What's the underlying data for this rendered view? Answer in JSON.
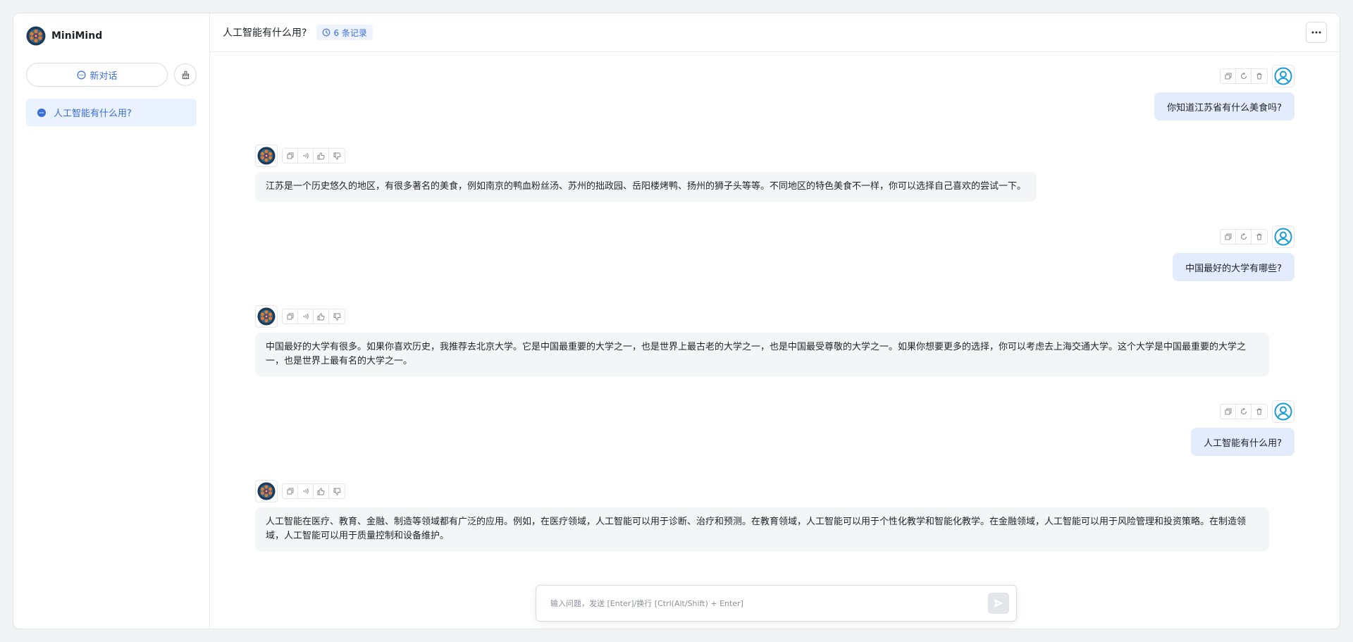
{
  "app": {
    "brand_name": "MiniMind"
  },
  "sidebar": {
    "new_chat_label": "新对话",
    "history": [
      {
        "label": "人工智能有什么用?"
      }
    ]
  },
  "header": {
    "title": "人工智能有什么用?",
    "record_count": "6 条记录"
  },
  "messages": [
    {
      "role": "user",
      "text": "你知道江苏省有什么美食吗?"
    },
    {
      "role": "assistant",
      "text": "江苏是一个历史悠久的地区，有很多著名的美食，例如南京的鸭血粉丝汤、苏州的拙政园、岳阳楼烤鸭、扬州的狮子头等等。不同地区的特色美食不一样，你可以选择自己喜欢的尝试一下。"
    },
    {
      "role": "user",
      "text": "中国最好的大学有哪些?"
    },
    {
      "role": "assistant",
      "text": "中国最好的大学有很多。如果你喜欢历史，我推荐去北京大学。它是中国最重要的大学之一，也是世界上最古老的大学之一，也是中国最受尊敬的大学之一。如果你想要更多的选择，你可以考虑去上海交通大学。这个大学是中国最重要的大学之一，也是世界上最有名的大学之一。"
    },
    {
      "role": "user",
      "text": "人工智能有什么用?"
    },
    {
      "role": "assistant",
      "text": "人工智能在医疗、教育、金融、制造等领域都有广泛的应用。例如，在医疗领域，人工智能可以用于诊断、治疗和预测。在教育领域，人工智能可以用于个性化教学和智能化教学。在金融领域，人工智能可以用于风险管理和投资策略。在制造领域，人工智能可以用于质量控制和设备维护。"
    }
  ],
  "input": {
    "placeholder": "输入问题，发送 [Enter]/换行 [Ctrl(Alt/Shift) + Enter]",
    "value": ""
  },
  "colors": {
    "accent": "#3b6fd6",
    "user_bubble": "#e3ecfd",
    "ai_bubble": "#f4f5f7",
    "avatar_blue": "#1a9bd7"
  }
}
